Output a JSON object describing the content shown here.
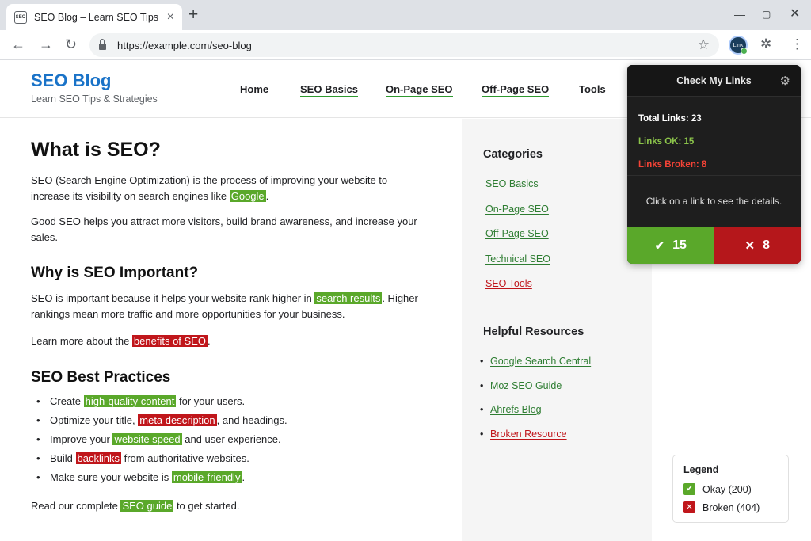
{
  "browser": {
    "tab_title": "SEO Blog – Learn SEO Tips",
    "favicon_text": "SEO",
    "url": "https://example.com/seo-blog",
    "extension_badge": "Link"
  },
  "site": {
    "title": "SEO Blog",
    "tagline": "Learn SEO Tips & Strategies",
    "nav": [
      "Home",
      "SEO Basics",
      "On-Page SEO",
      "Off-Page SEO",
      "Tools"
    ]
  },
  "article": {
    "title": "What is SEO?",
    "p1_text": "SEO (Search Engine Optimization) is the process of improving your website to increase its visibility on search engines like ",
    "p1_link": "Google",
    "p1_end": ".",
    "p2": "Good SEO helps you attract more visitors, build brand awareness, and increase your sales.",
    "h2_important": "Why is SEO Important?",
    "p3_text": "SEO is important because it helps your website rank higher in ",
    "p3_link": "search results",
    "p3_end": ". Higher rankings mean more traffic and more opportunities for your business.",
    "p4_text": "Learn more about the ",
    "p4_link": "benefits of SEO",
    "p4_end": ".",
    "h2_practices": "SEO Best Practices",
    "bullets": [
      {
        "pre": "Create ",
        "link": "high-quality content",
        "post": " for your users."
      },
      {
        "pre": "Optimize your title, ",
        "link": "meta description",
        "post": ", and headings."
      },
      {
        "pre": "Improve your ",
        "link": "website speed",
        "post": " and user experience."
      },
      {
        "pre": "Build ",
        "link": "backlinks",
        "post": " from authoritative websites."
      },
      {
        "pre": "Make sure your website is ",
        "link": "mobile-friendly",
        "post": "."
      }
    ],
    "p5_text": "Read our complete ",
    "p5_link": "SEO guide",
    "p5_end": " to get started."
  },
  "sidebar": {
    "categories_title": "Categories",
    "categories": [
      "SEO Basics",
      "On-Page SEO",
      "Off-Page SEO",
      "Technical SEO",
      "SEO Tools"
    ],
    "resources_title": "Helpful Resources",
    "resources": [
      "Google Search Central",
      "Moz SEO Guide",
      "Ahrefs Blog",
      "Broken Resource"
    ]
  },
  "popup": {
    "title": "Check My Links",
    "total": "Total Links: 23",
    "ok": "Links OK: 15",
    "broken": "Links Broken: 8",
    "note": "Click on a link to see the details.",
    "ok_count": "15",
    "broken_count": "8"
  },
  "legend": {
    "title": "Legend",
    "ok": "Okay (200)",
    "broken": "Broken (404)"
  },
  "colors": {
    "ok": "#5aa82a",
    "broken": "#c0161b",
    "brand": "#1a73c8",
    "popup_ok_text": "#8bc34a",
    "popup_broken_text": "#f44336"
  },
  "icons": {
    "back": "arrow-left-icon",
    "forward": "arrow-right-icon",
    "reload": "reload-icon",
    "lock": "lock-icon",
    "star": "star-icon",
    "extensions": "puzzle-icon",
    "menu": "kebab-menu-icon",
    "settings": "gear-icon",
    "check": "check-icon",
    "cross": "x-icon"
  }
}
